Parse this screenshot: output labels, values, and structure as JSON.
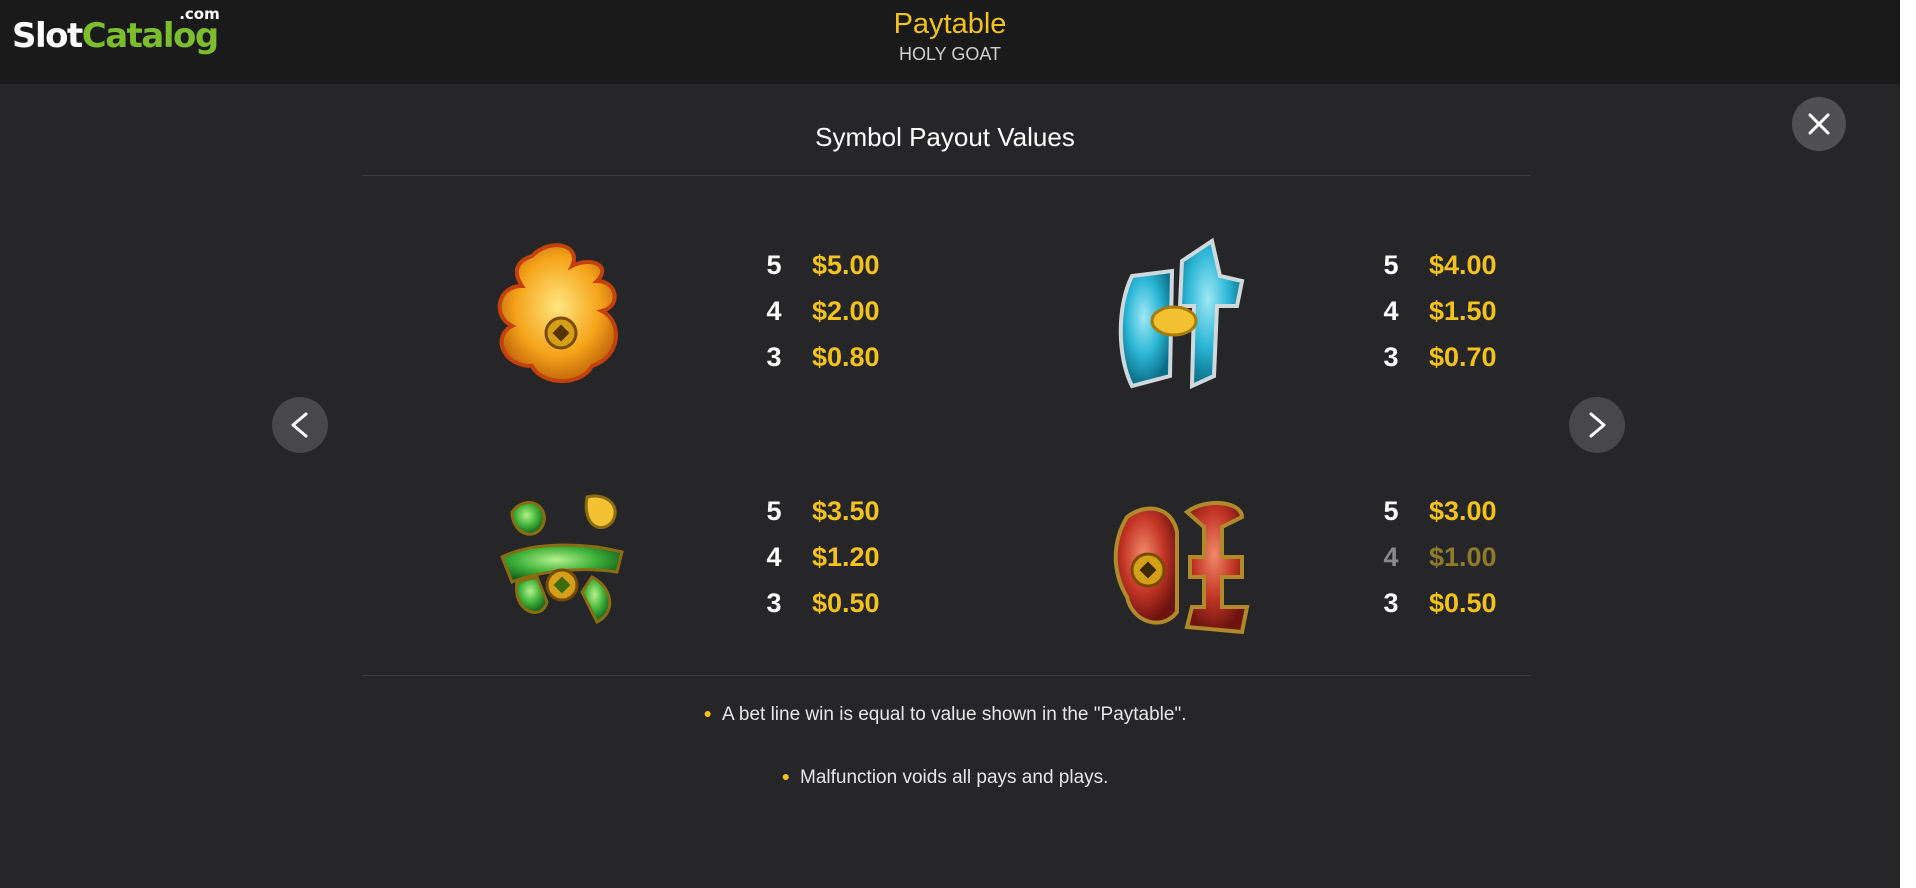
{
  "logo": {
    "slot": "Slot",
    "catalog": "Catalog",
    "com": ".com"
  },
  "header": {
    "title": "Paytable",
    "game_name": "HOLY GOAT"
  },
  "section": {
    "title": "Symbol Payout Values"
  },
  "symbols": [
    {
      "name": "gold-character-symbol",
      "color": "#f3a21d",
      "pays": [
        {
          "count": "5",
          "value": "$5.00"
        },
        {
          "count": "4",
          "value": "$2.00"
        },
        {
          "count": "3",
          "value": "$0.80"
        }
      ]
    },
    {
      "name": "blue-character-symbol",
      "color": "#2cb6d6",
      "pays": [
        {
          "count": "5",
          "value": "$4.00"
        },
        {
          "count": "4",
          "value": "$1.50"
        },
        {
          "count": "3",
          "value": "$0.70"
        }
      ]
    },
    {
      "name": "green-character-symbol",
      "color": "#3fb33b",
      "pays": [
        {
          "count": "5",
          "value": "$3.50"
        },
        {
          "count": "4",
          "value": "$1.20"
        },
        {
          "count": "3",
          "value": "$0.50"
        }
      ]
    },
    {
      "name": "red-character-symbol",
      "color": "#c43626",
      "pays": [
        {
          "count": "5",
          "value": "$3.00"
        },
        {
          "count": "4",
          "value": "$1.00"
        },
        {
          "count": "3",
          "value": "$0.50"
        }
      ]
    }
  ],
  "notes": [
    "A bet line win is equal to value shown in the \"Paytable\".",
    "Malfunction voids all pays and plays."
  ],
  "nav": {
    "prev_icon": "chevron-left-icon",
    "next_icon": "chevron-right-icon",
    "close_icon": "close-icon"
  },
  "colors": {
    "accent": "#f3c21d",
    "background": "#262628",
    "header_bg": "#1a1a1b"
  }
}
